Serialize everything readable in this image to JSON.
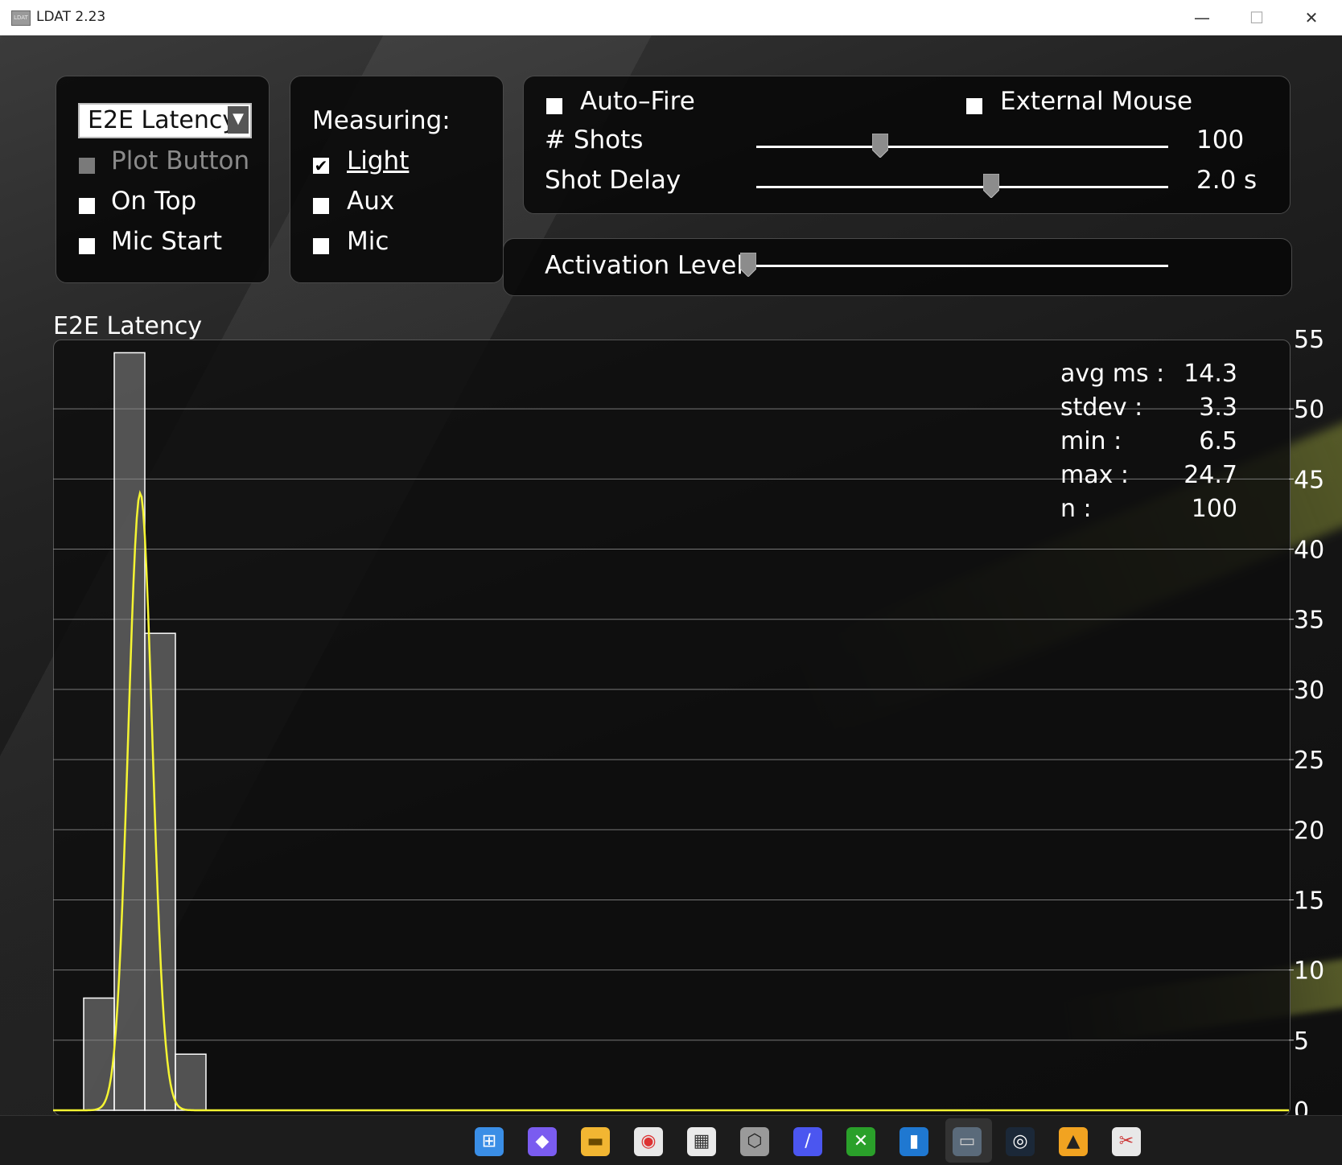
{
  "window": {
    "title": "LDAT 2.23",
    "icon_label": "LDAT",
    "minimize_glyph": "—",
    "maximize_glyph": "☐",
    "close_glyph": "✕"
  },
  "mode_panel": {
    "dropdown_value": "E2E  Latency",
    "dropdown_arrow": "▼",
    "plot_button": {
      "label": "Plot  Button",
      "checked": false,
      "enabled": false
    },
    "on_top": {
      "label": "On  Top",
      "checked": false
    },
    "mic_start": {
      "label": "Mic  Start",
      "checked": false
    }
  },
  "measure_panel": {
    "heading": "Measuring:",
    "light": {
      "label": "Light",
      "checked": true
    },
    "aux": {
      "label": "Aux",
      "checked": false
    },
    "mic": {
      "label": "Mic",
      "checked": false
    }
  },
  "shots_panel": {
    "auto_fire": {
      "label": "Auto–Fire",
      "checked": false
    },
    "external_mouse": {
      "label": "External  Mouse",
      "checked": false
    },
    "shots": {
      "label": "#  Shots",
      "value": "100",
      "slider_fraction": 0.3
    },
    "shot_delay": {
      "label": "Shot  Delay",
      "value": "2.0",
      "unit": "s",
      "slider_fraction": 0.57
    }
  },
  "activation_panel": {
    "label": "Activation  Level",
    "slider_fraction": 0.0
  },
  "stats": {
    "avg_label": "avg  ms  :",
    "avg_value": "14.3",
    "stdev_label": "stdev  :",
    "stdev_value": "3.3",
    "min_label": "min  :",
    "min_value": "6.5",
    "max_label": "max  :",
    "max_value": "24.7",
    "n_label": "n  :",
    "n_value": "100"
  },
  "chart_data": {
    "type": "bar",
    "title": "E2E  Latency",
    "bins": [
      {
        "x": 0,
        "value": 8
      },
      {
        "x": 1,
        "value": 54
      },
      {
        "x": 2,
        "value": 34
      },
      {
        "x": 3,
        "value": 4
      }
    ],
    "ylim": [
      0,
      55
    ],
    "yticks": [
      0,
      5,
      10,
      15,
      20,
      25,
      30,
      35,
      40,
      45,
      50,
      55
    ],
    "curve": {
      "type": "gaussian-fit",
      "peak": 44,
      "color": "#f5f532"
    },
    "grid": true,
    "colors": {
      "bar_fill": "#8a8a8a",
      "bar_stroke": "#ffffff",
      "grid": "#9a9a9a"
    }
  },
  "taskbar": {
    "icons": [
      "windows-start-icon",
      "copilot-icon",
      "file-explorer-icon",
      "chrome-icon",
      "microsoft-store-icon",
      "unity-icon",
      "app-icon",
      "xbox-icon",
      "equalizer-app-icon",
      "ldat-icon",
      "steam-icon",
      "counter-strike-icon",
      "snipping-tool-icon"
    ]
  }
}
